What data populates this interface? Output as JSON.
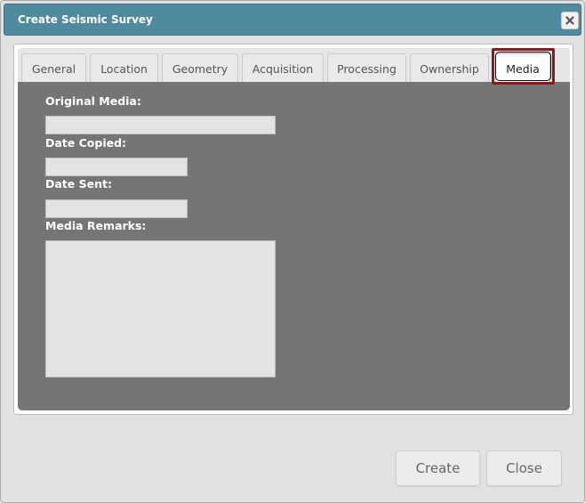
{
  "window": {
    "title": "Create Seismic Survey",
    "close_icon": "close-icon"
  },
  "tabs": [
    {
      "label": "General",
      "active": false
    },
    {
      "label": "Location",
      "active": false
    },
    {
      "label": "Geometry",
      "active": false
    },
    {
      "label": "Acquisition",
      "active": false
    },
    {
      "label": "Processing",
      "active": false
    },
    {
      "label": "Ownership",
      "active": false
    },
    {
      "label": "Media",
      "active": true
    }
  ],
  "form": {
    "original_media": {
      "label": "Original Media:",
      "value": ""
    },
    "date_copied": {
      "label": "Date Copied:",
      "value": ""
    },
    "date_sent": {
      "label": "Date Sent:",
      "value": ""
    },
    "media_remarks": {
      "label": "Media Remarks:",
      "value": ""
    }
  },
  "footer": {
    "create_label": "Create",
    "close_label": "Close"
  },
  "colors": {
    "titlebar": "#4f8a9e",
    "panel": "#757575",
    "highlight": "#8b1a1a"
  }
}
